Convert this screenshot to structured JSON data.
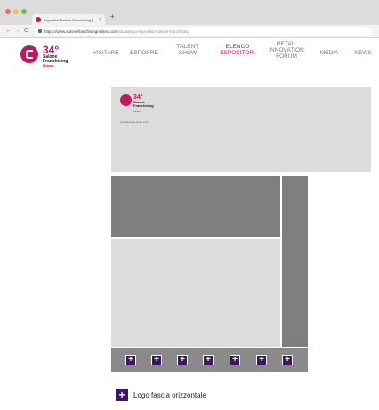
{
  "browser": {
    "tab_title": "Espositori Salone Franchising | ",
    "tab_close": "×",
    "new_tab": "+",
    "back": "←",
    "forward": "→",
    "reload": "C",
    "url_host": "https://www.salonefranchisingmilano.com",
    "url_path": "/it/catalogo-espositori-salone-franchising"
  },
  "site": {
    "logo": {
      "number": "34°",
      "line1": "Salone",
      "line2": "Franchising",
      "city": "Milano"
    },
    "nav": [
      {
        "label": "VISITARE",
        "active": false
      },
      {
        "label": "ESPORRE",
        "active": false
      },
      {
        "label": "TALENT SHOW",
        "active": false
      },
      {
        "label": "ELENCO ESPOSITORI",
        "active": true
      },
      {
        "label": "RETAIL INNOVATION FORUM",
        "active": false
      },
      {
        "label": "MEDIA",
        "active": false
      },
      {
        "label": "NEWS",
        "active": false
      }
    ]
  },
  "stand_map": {
    "mini_logo": {
      "number": "34°",
      "line1": "Salone",
      "line2": "Franchising",
      "city": "Milano",
      "sub": "INTERNATIONAL RETAIL EXPO"
    },
    "plus_label": "+",
    "plus_count": 7
  },
  "legend": {
    "icon": "+",
    "label": "Logo fascia orizzontale"
  },
  "colors": {
    "brand": "#c2185b",
    "button": "#3d1466",
    "light_panel": "#dcdcdc",
    "dark_panel": "#7f7f7f"
  }
}
